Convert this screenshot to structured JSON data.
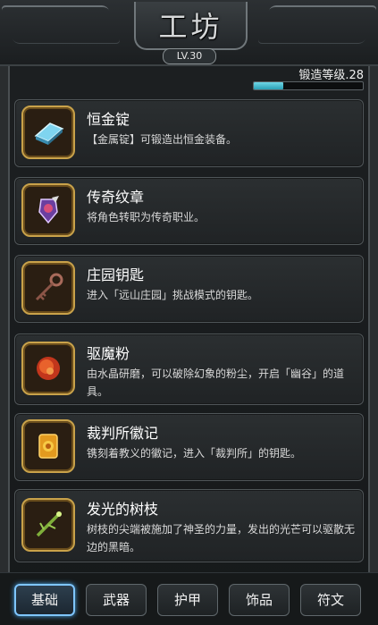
{
  "header": {
    "title": "工坊",
    "level": "LV.30"
  },
  "forge": {
    "label": "锻造等级.28",
    "progress": 0.27
  },
  "items": [
    {
      "name": "恒金锭",
      "desc": "【金属锭】可锻造出恒金装备。",
      "icon": "ingot-icon"
    },
    {
      "name": "传奇纹章",
      "desc": "将角色转职为传奇职业。",
      "icon": "crest-icon"
    },
    {
      "name": "庄园钥匙",
      "desc": "进入「远山庄园」挑战模式的钥匙。",
      "icon": "key-icon"
    },
    {
      "name": "驱魔粉",
      "desc": "由水晶研磨，可以破除幻象的粉尘，开启「幽谷」的道具。",
      "icon": "powder-icon"
    },
    {
      "name": "裁判所徽记",
      "desc": "镌刻着教义的徽记，进入「裁判所」的钥匙。",
      "icon": "badge-icon"
    },
    {
      "name": "发光的树枝",
      "desc": "树枝的尖端被施加了神圣的力量，发出的光芒可以驱散无边的黑暗。",
      "icon": "branch-icon"
    }
  ],
  "tabs": [
    {
      "label": "基础",
      "active": true
    },
    {
      "label": "武器",
      "active": false
    },
    {
      "label": "护甲",
      "active": false
    },
    {
      "label": "饰品",
      "active": false
    },
    {
      "label": "符文",
      "active": false
    }
  ]
}
